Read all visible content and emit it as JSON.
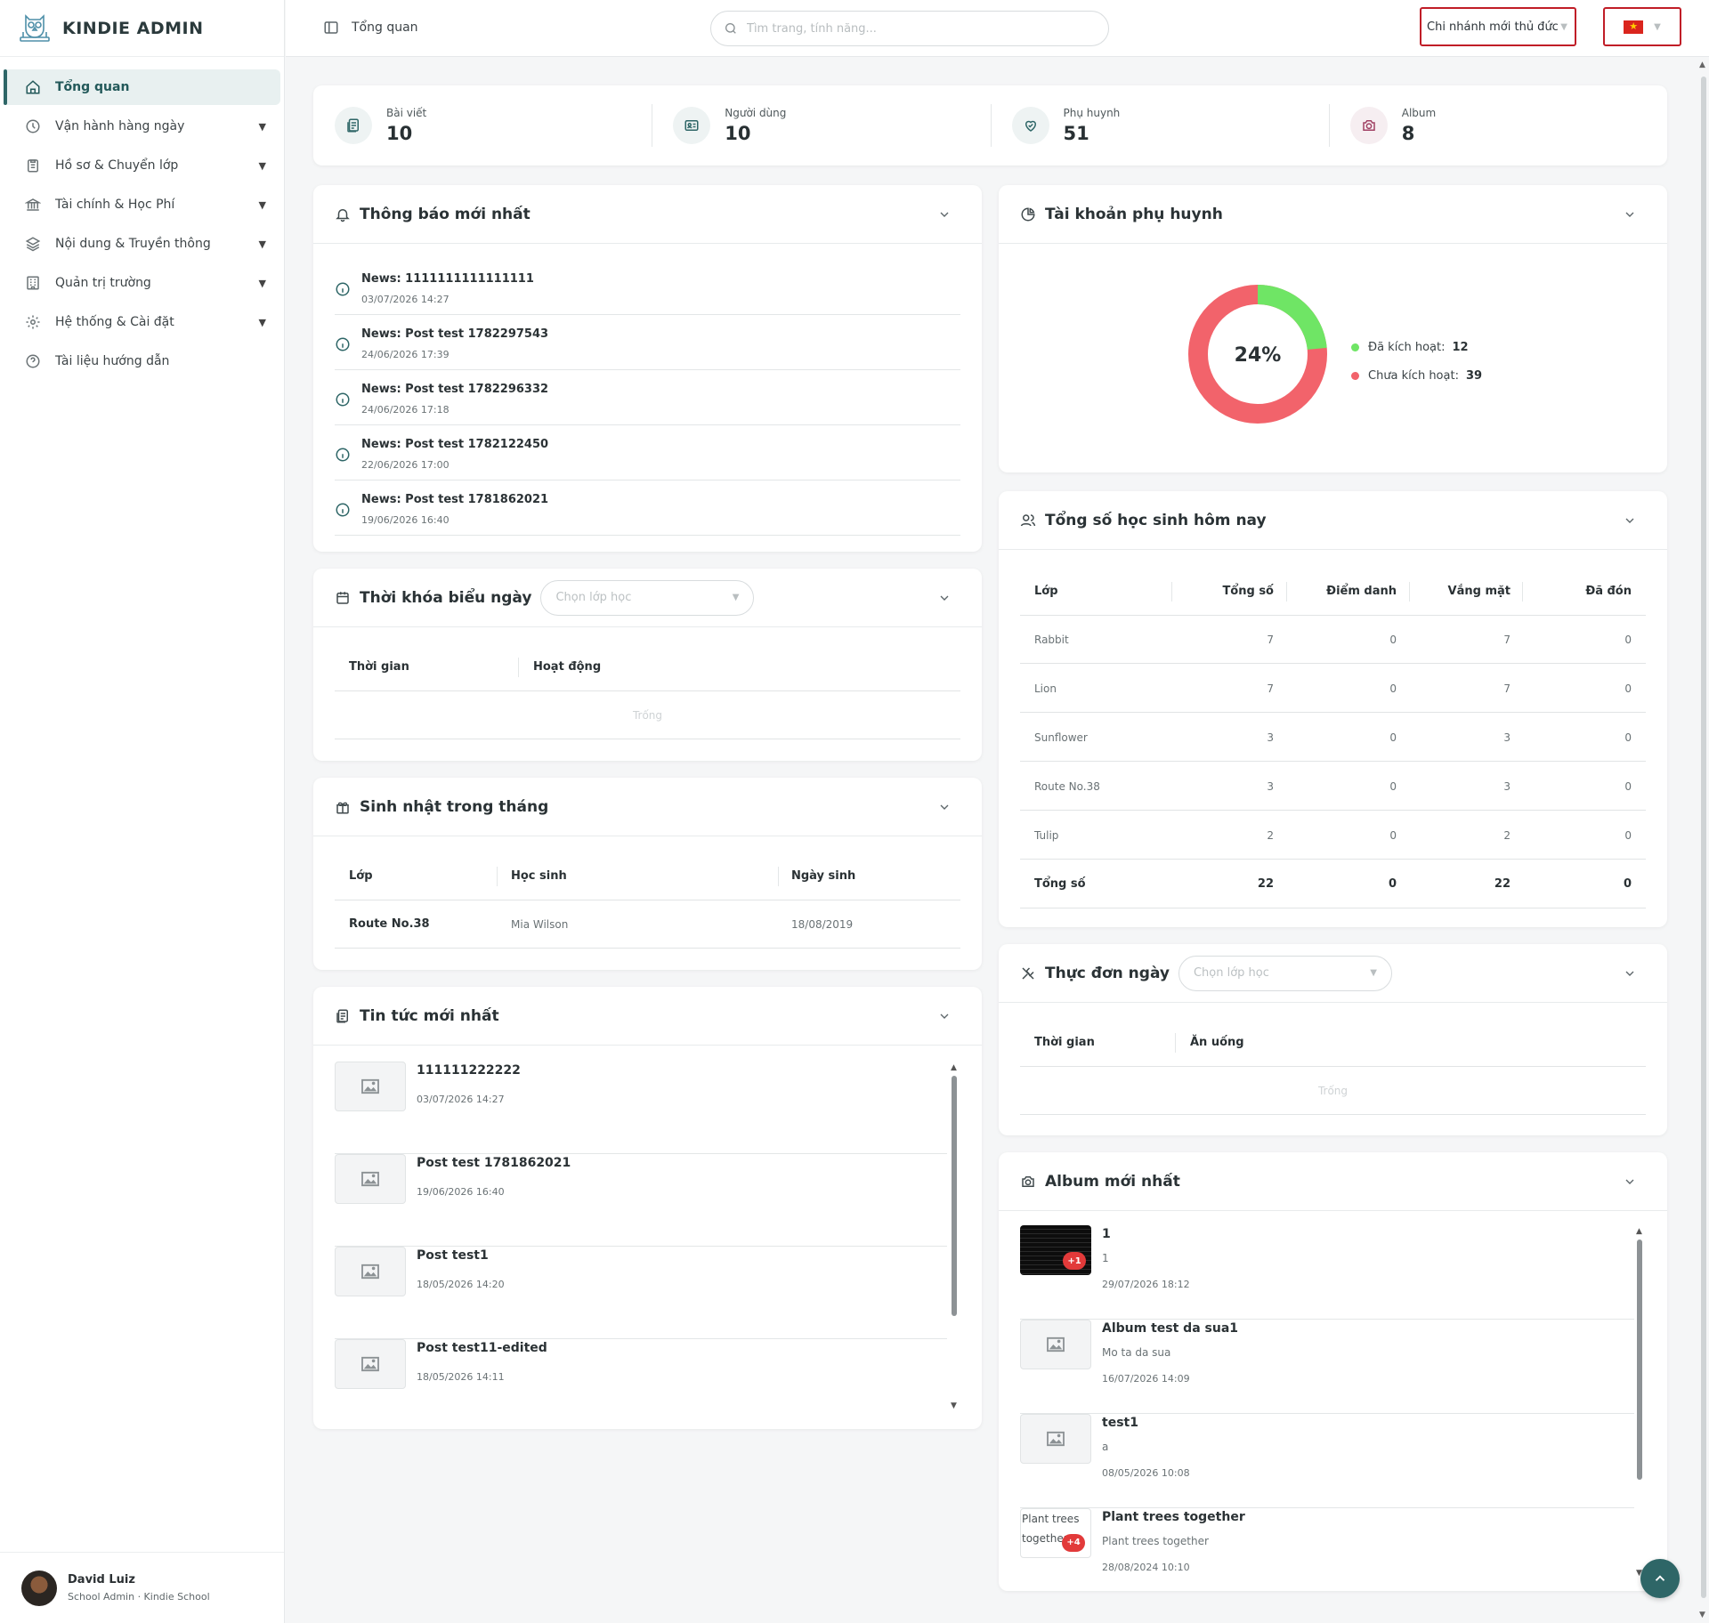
{
  "brand": {
    "name": "KINDIE ADMIN"
  },
  "sidebar": {
    "items": [
      {
        "label": "Tổng quan",
        "icon": "home-icon",
        "active": true
      },
      {
        "label": "Vận hành hàng ngày",
        "icon": "clock-icon"
      },
      {
        "label": "Hồ sơ & Chuyển lớp",
        "icon": "clipboard-icon"
      },
      {
        "label": "Tài chính & Học Phí",
        "icon": "bank-icon"
      },
      {
        "label": "Nội dung & Truyền thông",
        "icon": "layers-icon"
      },
      {
        "label": "Quản trị trường",
        "icon": "building-icon"
      },
      {
        "label": "Hệ thống & Cài đặt",
        "icon": "gear-icon"
      },
      {
        "label": "Tài liệu hướng dẫn",
        "icon": "help-icon"
      }
    ]
  },
  "user": {
    "name": "David Luiz",
    "role": "School Admin · Kindie School"
  },
  "topbar": {
    "page_title": "Tổng quan",
    "search_placeholder": "Tìm trang, tính năng...",
    "branch": "Chi nhánh mới thủ đức",
    "language": "vi"
  },
  "stats": [
    {
      "label": "Bài viết",
      "value": "10",
      "icon": "article-icon"
    },
    {
      "label": "Người dùng",
      "value": "10",
      "icon": "id-card-icon"
    },
    {
      "label": "Phụ huynh",
      "value": "51",
      "icon": "heart-hand-icon"
    },
    {
      "label": "Album",
      "value": "8",
      "icon": "camera-icon"
    }
  ],
  "notices": {
    "title": "Thông báo mới nhất",
    "items": [
      {
        "title": "News: 1111111111111111",
        "date": "03/07/2026 14:27"
      },
      {
        "title": "News: Post test 1782297543",
        "date": "24/06/2026 17:39"
      },
      {
        "title": "News: Post test 1782296332",
        "date": "24/06/2026 17:18"
      },
      {
        "title": "News: Post test 1782122450",
        "date": "22/06/2026 17:00"
      },
      {
        "title": "News: Post test 1781862021",
        "date": "19/06/2026 16:40"
      }
    ]
  },
  "timetable": {
    "title": "Thời khóa biểu ngày",
    "select_placeholder": "Chọn lớp học",
    "columns": [
      "Thời gian",
      "Hoạt động"
    ],
    "empty": "Trống"
  },
  "birthday": {
    "title": "Sinh nhật trong tháng",
    "columns": [
      "Lớp",
      "Học sinh",
      "Ngày sinh"
    ],
    "rows": [
      {
        "class": "Route No.38",
        "student": "Mia Wilson",
        "dob": "18/08/2019"
      }
    ]
  },
  "news": {
    "title": "Tin tức mới nhất",
    "items": [
      {
        "title": "111111222222",
        "date": "03/07/2026 14:27"
      },
      {
        "title": "Post test 1781862021",
        "date": "19/06/2026 16:40"
      },
      {
        "title": "Post test1",
        "date": "18/05/2026 14:20"
      },
      {
        "title": "Post test11-edited",
        "date": "18/05/2026 14:11"
      }
    ]
  },
  "parents": {
    "title": "Tài khoản phụ huynh",
    "percent_label": "24%",
    "activated_label": "Đã kích hoạt:",
    "activated": 12,
    "inactive_label": "Chưa kích hoạt:",
    "inactive": 39,
    "colors": {
      "activated": "#6fe565",
      "inactive": "#f2636b"
    }
  },
  "students": {
    "title": "Tổng số học sinh hôm nay",
    "columns": [
      "Lớp",
      "Tổng số",
      "Điểm danh",
      "Vắng mặt",
      "Đã đón"
    ],
    "rows": [
      [
        "Rabbit",
        "7",
        "0",
        "7",
        "0"
      ],
      [
        "Lion",
        "7",
        "0",
        "7",
        "0"
      ],
      [
        "Sunflower",
        "3",
        "0",
        "3",
        "0"
      ],
      [
        "Route No.38",
        "3",
        "0",
        "3",
        "0"
      ],
      [
        "Tulip",
        "2",
        "0",
        "2",
        "0"
      ],
      [
        "Tổng số",
        "22",
        "0",
        "22",
        "0"
      ]
    ]
  },
  "menu": {
    "title": "Thực đơn ngày",
    "select_placeholder": "Chọn lớp học",
    "columns": [
      "Thời gian",
      "Ăn uống"
    ],
    "empty": "Trống"
  },
  "albums": {
    "title": "Album mới nhất",
    "items": [
      {
        "title": "1",
        "desc": "1",
        "date": "29/07/2026 18:12",
        "badge": "+1"
      },
      {
        "title": "Album test da sua1",
        "desc": "Mo ta da sua",
        "date": "16/07/2026 14:09"
      },
      {
        "title": "test1",
        "desc": "a",
        "date": "08/05/2026 10:08"
      },
      {
        "title": "Plant trees together",
        "desc": "Plant trees together",
        "date": "28/08/2024 10:10",
        "badge": "+4",
        "alt": "Plant trees together"
      }
    ]
  }
}
